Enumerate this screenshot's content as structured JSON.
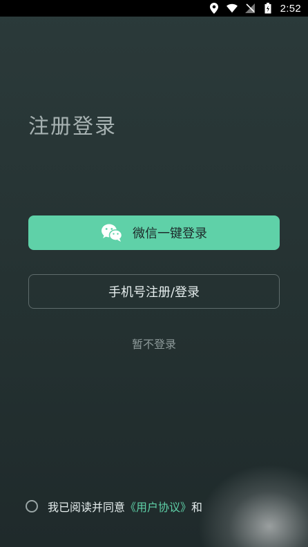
{
  "status_bar": {
    "time": "2:52",
    "icons": [
      "location-icon",
      "wifi-icon",
      "no-signal-icon",
      "battery-icon"
    ]
  },
  "page": {
    "title": "注册登录"
  },
  "buttons": {
    "wechat_label": "微信一键登录",
    "phone_label": "手机号注册/登录",
    "skip_label": "暂不登录"
  },
  "agreement": {
    "prefix": "我已阅读并同意",
    "link_label": "《用户协议》",
    "suffix": "和"
  },
  "colors": {
    "accent": "#5fd1a8",
    "background": "#263333",
    "title": "#a7b2b2",
    "muted": "#8d9999"
  }
}
